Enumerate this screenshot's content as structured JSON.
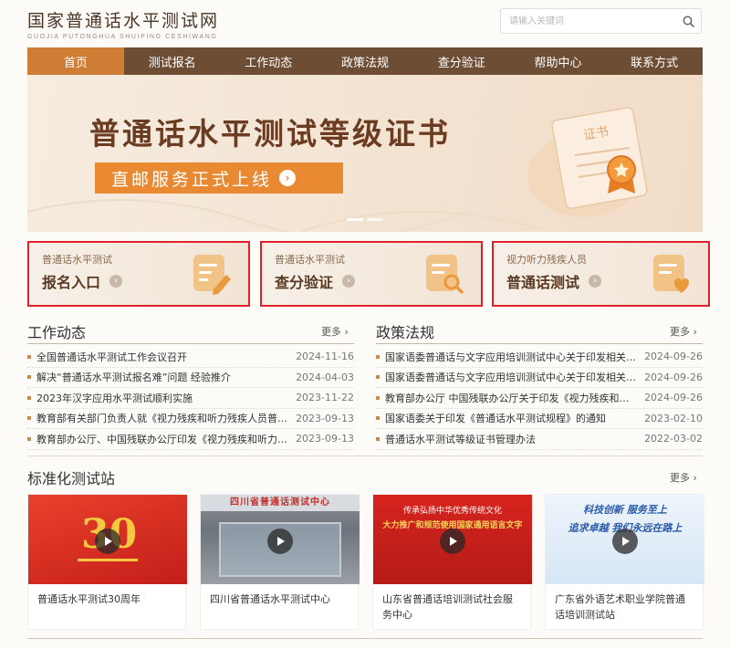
{
  "header": {
    "site_title": "国家普通话水平测试网",
    "site_subtitle": "GUOJIA PUTONGHUA SHUIPING CESHIWANG",
    "search_placeholder": "请输入关键词"
  },
  "nav": {
    "items": [
      {
        "label": "首页",
        "active": true
      },
      {
        "label": "测试报名",
        "active": false
      },
      {
        "label": "工作动态",
        "active": false
      },
      {
        "label": "政策法规",
        "active": false
      },
      {
        "label": "查分验证",
        "active": false
      },
      {
        "label": "帮助中心",
        "active": false
      },
      {
        "label": "联系方式",
        "active": false
      }
    ]
  },
  "banner": {
    "title": "普通话水平测试等级证书",
    "pill_text": "直邮服务正式上线",
    "certificate_text": "证书"
  },
  "quick_entries": [
    {
      "top": "普通话水平测试",
      "main": "报名入口",
      "icon": "edit-document-icon"
    },
    {
      "top": "普通话水平测试",
      "main": "查分验证",
      "icon": "search-document-icon"
    },
    {
      "top": "视力听力残疾人员",
      "main": "普通话测试",
      "icon": "heart-document-icon"
    }
  ],
  "work_news": {
    "title": "工作动态",
    "more": "更多 ›",
    "items": [
      {
        "title": "全国普通话水平测试工作会议召开",
        "date": "2024-11-16"
      },
      {
        "title": "解决“普通话水平测试报名难”问题 经验推介",
        "date": "2024-04-03"
      },
      {
        "title": "2023年汉字应用水平测试顺利实施",
        "date": "2023-11-22"
      },
      {
        "title": "教育部有关部门负责人就《视力残疾和听力残疾人员普通话水平测试暂行办法》答记者问",
        "date": "2023-09-13"
      },
      {
        "title": "教育部办公厅、中国残联办公厅印发《视力残疾和听力残疾人员普通话水平测试暂行办法》",
        "date": "2023-09-13"
      }
    ]
  },
  "policy": {
    "title": "政策法规",
    "more": "更多 ›",
    "items": [
      {
        "title": "国家语委普通话与文字应用培训测试中心关于印发相关文件的通知",
        "date": "2024-09-26"
      },
      {
        "title": "国家语委普通话与文字应用培训测试中心关于印发相关办法的通知",
        "date": "2024-09-26"
      },
      {
        "title": "教育部办公厅 中国残联办公厅关于印发《视力残疾和听力残疾人员普通话水平测试暂行办法》的通知",
        "date": "2024-09-26"
      },
      {
        "title": "国家语委关于印发《普通话水平测试规程》的通知",
        "date": "2023-02-10"
      },
      {
        "title": "普通话水平测试等级证书管理办法",
        "date": "2022-03-02"
      }
    ]
  },
  "stations": {
    "title": "标准化测试站",
    "more": "更多 ›",
    "items": [
      {
        "caption": "普通话水平测试30周年",
        "thumb_text": "30"
      },
      {
        "caption": "四川省普通话水平测试中心",
        "thumb_text": "四川省普通话测试中心"
      },
      {
        "caption": "山东省普通话培训测试社会服务中心",
        "thumb_text_1": "传承弘扬中华优秀传统文化",
        "thumb_text_2": "大力推广和规范使用国家通用语言文字"
      },
      {
        "caption": "广东省外语艺术职业学院普通话培训测试站",
        "thumb_text_1": "科技创新 服务至上",
        "thumb_text_2": "追求卓越 我们永远在路上"
      }
    ]
  },
  "colors": {
    "nav_bg": "#6d4d34",
    "nav_active": "#cf7d34",
    "banner_pill": "#e98a32",
    "highlight_border": "#e0202a"
  }
}
